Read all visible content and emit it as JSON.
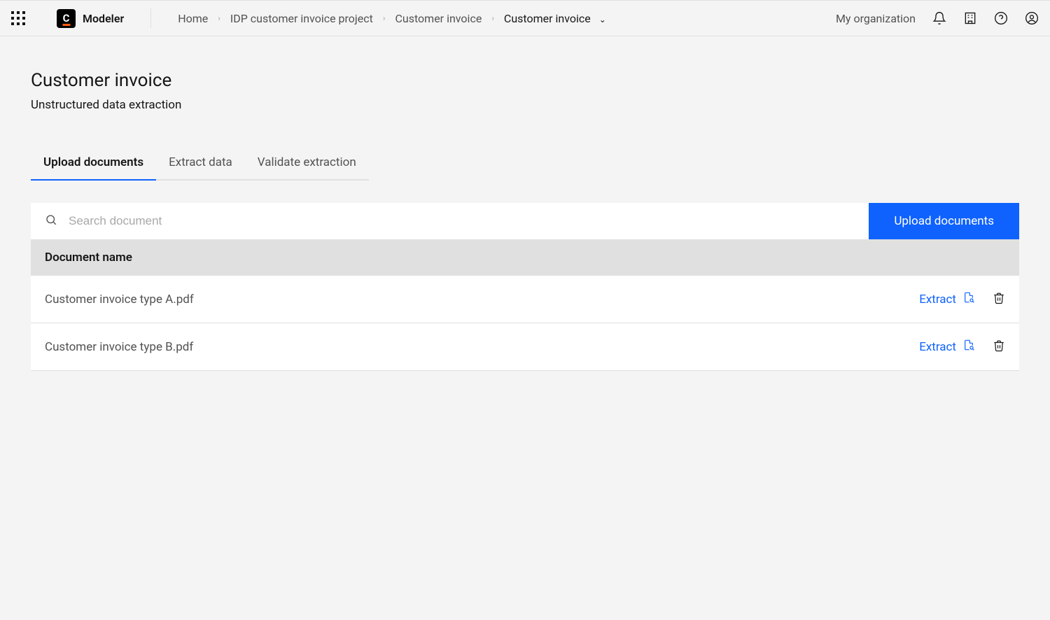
{
  "brand": {
    "logo_text": "C",
    "name": "Modeler"
  },
  "breadcrumbs": {
    "items": [
      {
        "label": "Home"
      },
      {
        "label": "IDP customer invoice project"
      },
      {
        "label": "Customer invoice"
      },
      {
        "label": "Customer invoice",
        "current": true
      }
    ]
  },
  "header": {
    "org_link": "My organization"
  },
  "page": {
    "title": "Customer invoice",
    "subtitle": "Unstructured data extraction"
  },
  "tabs": [
    {
      "label": "Upload documents",
      "active": true
    },
    {
      "label": "Extract data",
      "active": false
    },
    {
      "label": "Validate extraction",
      "active": false
    }
  ],
  "search": {
    "placeholder": "Search document",
    "value": ""
  },
  "upload_button": "Upload documents",
  "table": {
    "header": "Document name",
    "rows": [
      {
        "name": "Customer invoice type A.pdf",
        "action_label": "Extract"
      },
      {
        "name": "Customer invoice type B.pdf",
        "action_label": "Extract"
      }
    ]
  }
}
